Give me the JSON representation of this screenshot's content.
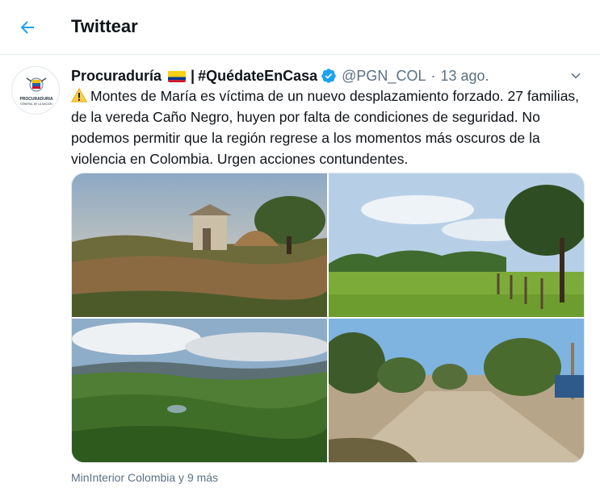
{
  "header": {
    "title": "Twittear"
  },
  "tweet": {
    "author_name": "Procuraduría",
    "author_suffix": "#QuédateEnCasa",
    "handle": "@PGN_COL",
    "separator": "·",
    "date": "13 ago.",
    "avatar_text": [
      "PROCURADURIA",
      "GENERAL DE LA NACION"
    ],
    "text": "Montes de María es víctima de un nuevo desplazamiento forzado. 27 familias, de la vereda Caño Negro, huyen por falta de condiciones de seguridad. No podemos permitir que la región regrese a los momentos más oscuros de la violencia en Colombia. Urgen acciones contundentes.",
    "tagged": "MinInterior Colombia y 9 más",
    "photos": [
      "photo-house",
      "photo-fence",
      "photo-hills",
      "photo-road"
    ]
  },
  "icons": {
    "back": "arrow-left-icon",
    "verified": "verified-badge-icon",
    "warning": "warning-icon",
    "more": "chevron-down-icon"
  },
  "colors": {
    "accent": "#1da1f2",
    "secondary_text": "#5b7083",
    "border": "#e6ecf0",
    "warning": "#ffcc4d"
  }
}
